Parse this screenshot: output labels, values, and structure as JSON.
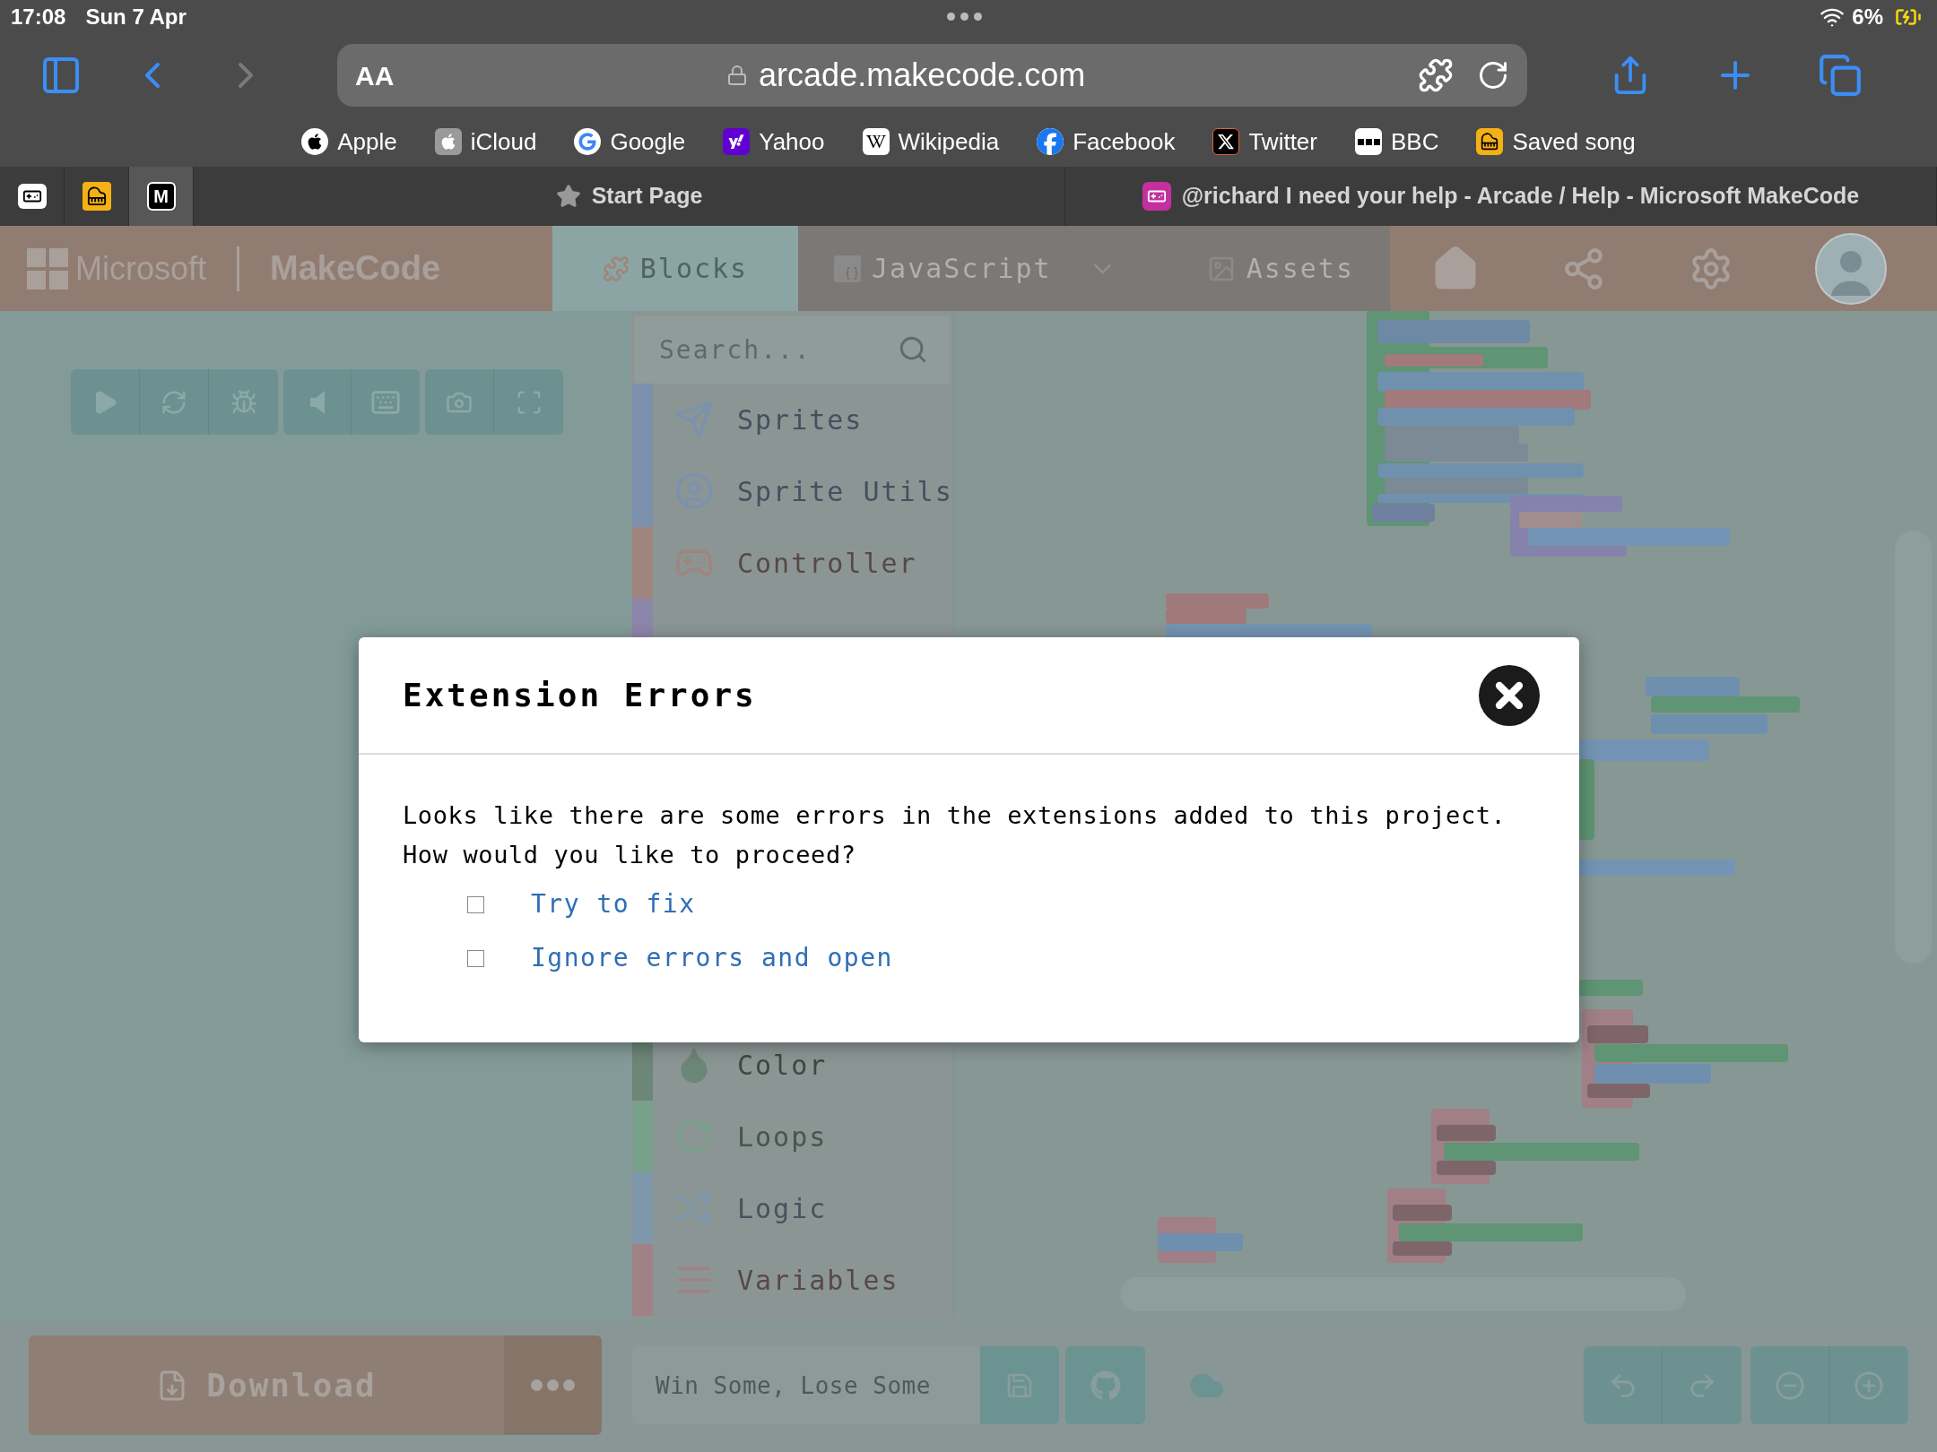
{
  "status_bar": {
    "time": "17:08",
    "date": "Sun 7 Apr",
    "battery": "6%"
  },
  "browser": {
    "text_size_button": "AA",
    "url": "arcade.makecode.com"
  },
  "favorites": [
    {
      "label": "Apple",
      "kind": "apple"
    },
    {
      "label": "iCloud",
      "kind": "icloud"
    },
    {
      "label": "Google",
      "kind": "google"
    },
    {
      "label": "Yahoo",
      "kind": "yahoo"
    },
    {
      "label": "Wikipedia",
      "kind": "wikipedia"
    },
    {
      "label": "Facebook",
      "kind": "facebook"
    },
    {
      "label": "Twitter",
      "kind": "twitter"
    },
    {
      "label": "BBC",
      "kind": "bbc"
    },
    {
      "label": "Saved song",
      "kind": "piano"
    }
  ],
  "pinned_tabs": [
    {
      "kind": "controller",
      "selected": false
    },
    {
      "kind": "piano",
      "selected": false
    },
    {
      "kind": "letter",
      "label": "M",
      "selected": true
    }
  ],
  "tabs": [
    {
      "title": "Start Page",
      "kind": "start",
      "selected": false
    },
    {
      "title": "@richard I need your help - Arcade / Help - Microsoft MakeCode",
      "kind": "site",
      "selected": false
    }
  ],
  "app_header": {
    "brand": "Microsoft",
    "product": "MakeCode",
    "editor_tabs": [
      {
        "label": "Blocks",
        "kind": "blocks",
        "selected": true
      },
      {
        "label": "JavaScript",
        "kind": "javascript",
        "selected": false
      },
      {
        "label": "Assets",
        "kind": "assets",
        "selected": false
      }
    ]
  },
  "toolbox": {
    "search": {
      "placeholder": "Search..."
    },
    "categories": [
      {
        "label": "Sprites",
        "kind": "sprites",
        "color": "#7b91ad"
      },
      {
        "label": "Sprite Utils",
        "kind": "sprite_utils",
        "color": "#7b91ad"
      },
      {
        "label": "Controller",
        "kind": "controller",
        "color": "#a0847e"
      },
      {
        "label": "Color",
        "kind": "color",
        "color": "#6c8677"
      },
      {
        "label": "Loops",
        "kind": "loops",
        "color": "#79a08b"
      },
      {
        "label": "Logic",
        "kind": "logic",
        "color": "#7f97ab"
      },
      {
        "label": "Variables",
        "kind": "variables",
        "color": "#a08286"
      }
    ]
  },
  "dialog": {
    "title": "Extension Errors",
    "message": "Looks like there are some errors in the extensions added to this project. How would you like to proceed?",
    "options": [
      {
        "label": "Try to fix",
        "checked": false
      },
      {
        "label": "Ignore errors and open",
        "checked": false
      }
    ]
  },
  "bottom_bar": {
    "download_button": "Download",
    "project_name": "Win Some, Lose Some"
  }
}
